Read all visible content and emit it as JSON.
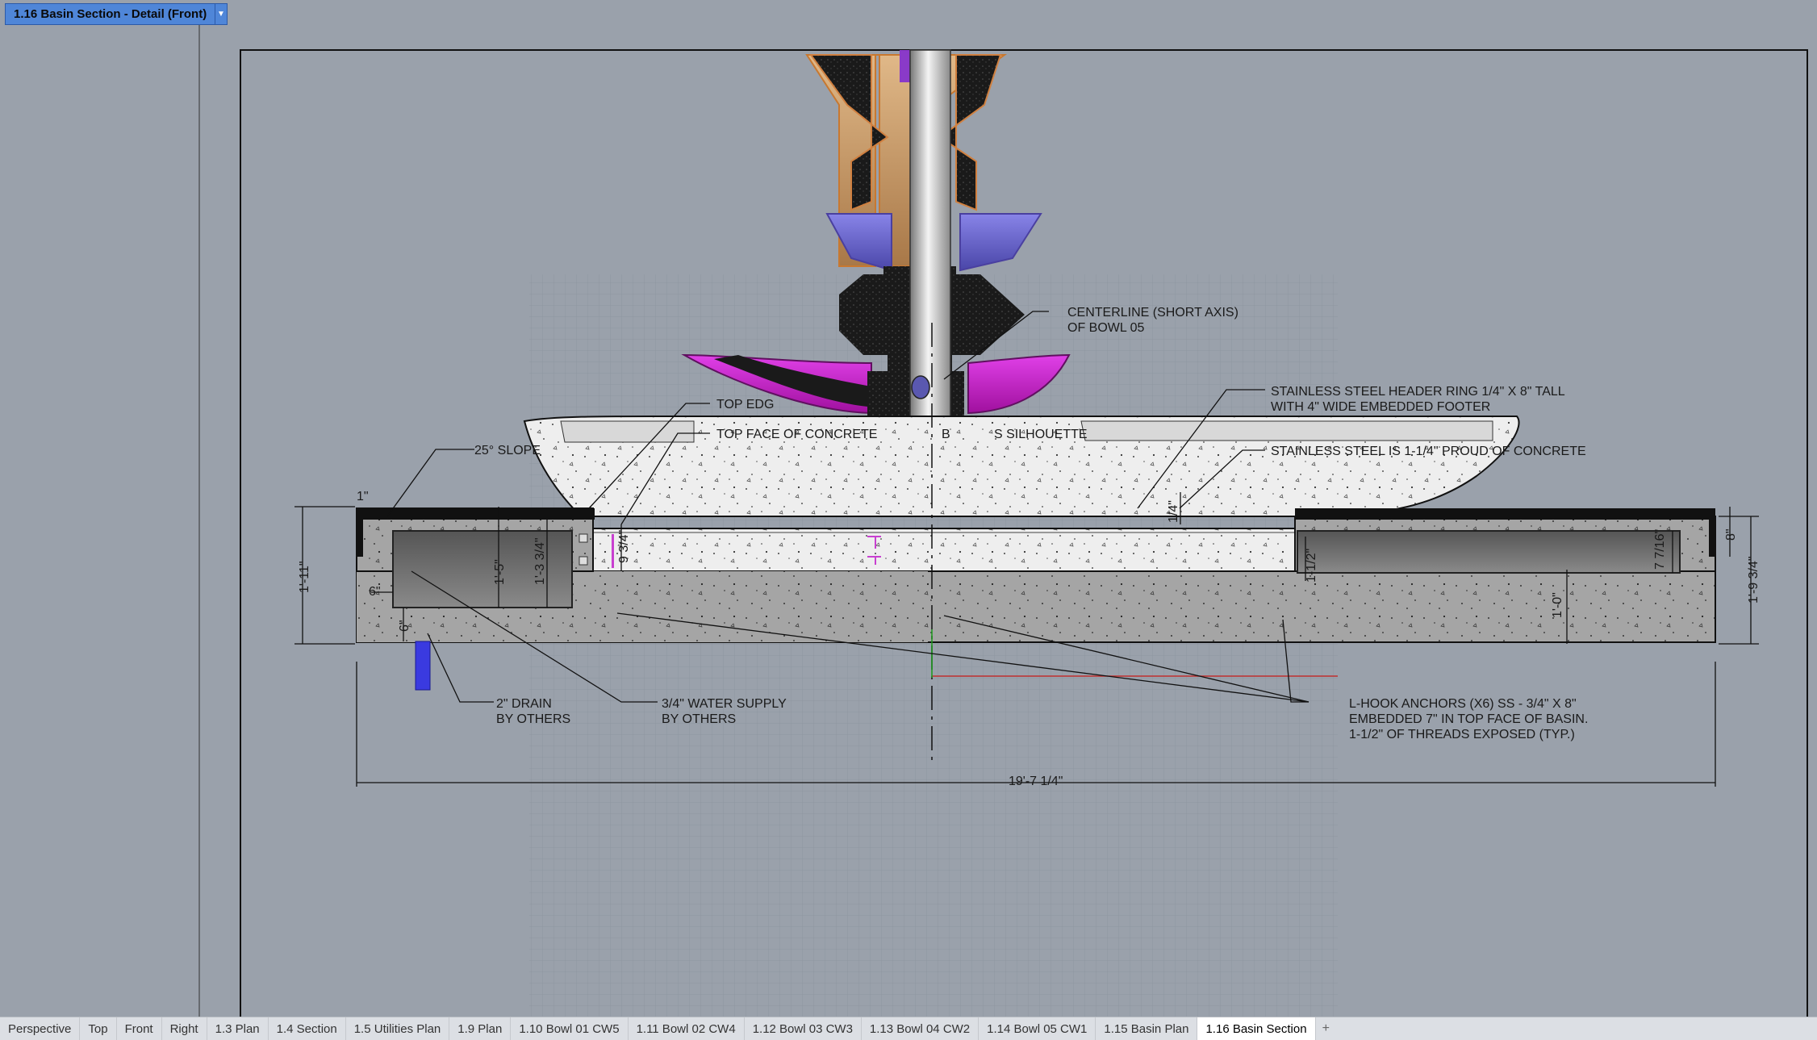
{
  "viewport": {
    "title": "1.16 Basin Section - Detail (Front)",
    "dropdown_icon": "triangle-down-icon"
  },
  "annotations": {
    "centerline": [
      "CENTERLINE (SHORT AXIS)",
      "OF BOWL 05"
    ],
    "header_ring": [
      "STAINLESS STEEL HEADER RING 1/4\" X 8\" TALL",
      "WITH 4\" WIDE EMBEDDED FOOTER"
    ],
    "proud": "STAINLESS STEEL IS 1-1/4\" PROUD OF CONCRETE",
    "top_edge": "TOP EDG",
    "top_face": "TOP FACE OF CONCRETE",
    "silhouette": "B",
    "silhouette2": "S SILHOUETTE",
    "slope": "25° SLOPE",
    "drain": [
      "2\" DRAIN",
      "BY OTHERS"
    ],
    "water_supply": [
      "3/4\" WATER SUPPLY",
      "BY OTHERS"
    ],
    "l_hook": [
      "L-HOOK ANCHORS (X6) SS - 3/4\" X 8\"",
      "EMBEDDED 7\" IN TOP FACE OF BASIN.",
      "1-1/2\" OF THREADS EXPOSED (TYP.)"
    ]
  },
  "dimensions": {
    "overall_width": "19'-7 1/4\"",
    "left_height": "1'-11\"",
    "right_height": "1'-9 3/4\"",
    "right_top": "8\"",
    "trough_depth": "1'-5\"",
    "trough_depth2": "1'-3 3/4\"",
    "inner": "9 3/4\"",
    "six_a": "6\"",
    "six_b": "6\"",
    "one": "1\"",
    "quarter": "1/4\"",
    "half": "1-1/2\"",
    "seven": "7 7/16\"",
    "one_ft": "1'-0\""
  },
  "tabs": [
    {
      "label": "Perspective",
      "active": false
    },
    {
      "label": "Top",
      "active": false
    },
    {
      "label": "Front",
      "active": false
    },
    {
      "label": "Right",
      "active": false
    },
    {
      "label": "1.3 Plan",
      "active": false
    },
    {
      "label": "1.4 Section",
      "active": false
    },
    {
      "label": "1.5 Utilities Plan",
      "active": false
    },
    {
      "label": "1.9 Plan",
      "active": false
    },
    {
      "label": "1.10 Bowl 01 CW5",
      "active": false
    },
    {
      "label": "1.11 Bowl 02 CW4",
      "active": false
    },
    {
      "label": "1.12 Bowl 03 CW3",
      "active": false
    },
    {
      "label": "1.13 Bowl 04 CW2",
      "active": false
    },
    {
      "label": "1.14 Bowl 05 CW1",
      "active": false
    },
    {
      "label": "1.15 Basin Plan",
      "active": false
    },
    {
      "label": "1.16 Basin Section",
      "active": true
    }
  ],
  "add_tab_icon": "plus-icon",
  "colors": {
    "viewport_bg": "#9aa1ab",
    "magenta": "#c81ecf",
    "purple": "#6e6ad6",
    "copper": "#c8a070",
    "concrete": "#e8e8e8",
    "slab": "#a3a3a3"
  }
}
